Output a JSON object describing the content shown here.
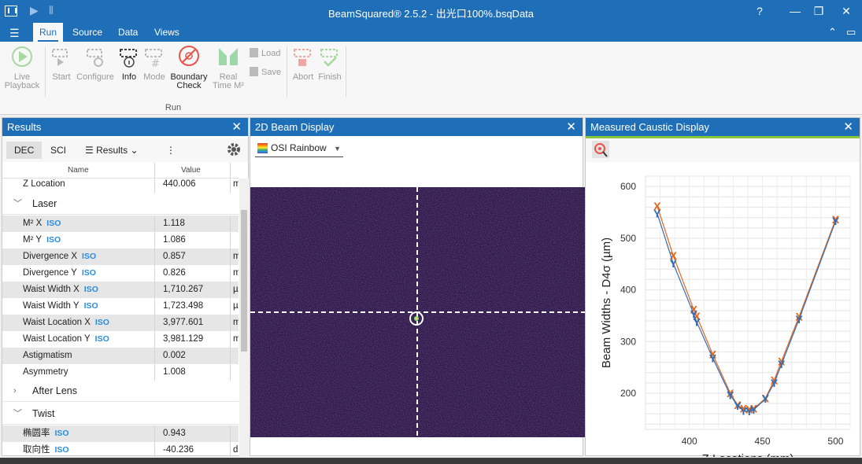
{
  "titlebar": {
    "title": "BeamSquared® 2.5.2 - 出光口100%.bsqData"
  },
  "menubar": {
    "tabs": [
      "Run",
      "Source",
      "Data",
      "Views"
    ]
  },
  "ribbon": {
    "live_playback": [
      "Live",
      "Playback"
    ],
    "start": "Start",
    "configure": "Configure",
    "info": "Info",
    "mode": "Mode",
    "boundary_check": [
      "Boundary",
      "Check"
    ],
    "real_time": [
      "Real",
      "Time M²"
    ],
    "load": "Load",
    "save": "Save",
    "abort": "Abort",
    "finish": "Finish",
    "group_label": "Run"
  },
  "results": {
    "title": "Results",
    "dec": "DEC",
    "sci": "SCI",
    "dropdown": "Results",
    "col_name": "Name",
    "col_value": "Value",
    "top_row": {
      "name": "Z Location",
      "value": "440.006",
      "unit": "m"
    },
    "group_laser": "Laser",
    "laser_rows": [
      {
        "name": "M² X",
        "iso": "ISO",
        "value": "1.118",
        "unit": ""
      },
      {
        "name": "M² Y",
        "iso": "ISO",
        "value": "1.086",
        "unit": ""
      },
      {
        "name": "Divergence X",
        "iso": "ISO",
        "value": "0.857",
        "unit": "m"
      },
      {
        "name": "Divergence Y",
        "iso": "ISO",
        "value": "0.826",
        "unit": "m"
      },
      {
        "name": "Waist Width X",
        "iso": "ISO",
        "value": "1,710.267",
        "unit": "µ"
      },
      {
        "name": "Waist Width Y",
        "iso": "ISO",
        "value": "1,723.498",
        "unit": "µ"
      },
      {
        "name": "Waist Location X",
        "iso": "ISO",
        "value": "3,977.601",
        "unit": "m"
      },
      {
        "name": "Waist Location Y",
        "iso": "ISO",
        "value": "3,981.129",
        "unit": "m"
      },
      {
        "name": "Astigmatism",
        "iso": "",
        "value": "0.002",
        "unit": ""
      },
      {
        "name": "Asymmetry",
        "iso": "",
        "value": "1.008",
        "unit": ""
      }
    ],
    "group_after_lens": "After Lens",
    "group_twist": "Twist",
    "twist_rows": [
      {
        "name": "椭圆率",
        "iso": "ISO",
        "value": "0.943",
        "unit": ""
      },
      {
        "name": "取向性",
        "iso": "ISO",
        "value": "-40.236",
        "unit": "d"
      }
    ]
  },
  "beam_display": {
    "title": "2D Beam Display",
    "colormap": "OSI Rainbow"
  },
  "caustic": {
    "title": "Measured Caustic Display"
  },
  "chart_data": {
    "type": "scatter",
    "xlabel": "Z Locations (mm)",
    "ylabel": "Beam Widths - D4σ (µm)",
    "xlim": [
      370,
      510
    ],
    "ylim": [
      130,
      620
    ],
    "x_ticks": [
      "400",
      "450",
      "500"
    ],
    "y_ticks": [
      "600",
      "500",
      "400",
      "300",
      "200"
    ],
    "grid": true,
    "legend": "none",
    "series": [
      {
        "marker": "X",
        "color": "#e8641a",
        "x": [
          378,
          389,
          403,
          405,
          416,
          428,
          433,
          437,
          441,
          444,
          452,
          458,
          463,
          475,
          500
        ],
        "y": [
          562,
          466,
          362,
          349,
          275,
          200,
          177,
          170,
          169,
          170,
          190,
          225,
          262,
          348,
          536
        ]
      },
      {
        "marker": "Y",
        "color": "#2f6db5",
        "x": [
          378,
          389,
          403,
          405,
          416,
          428,
          433,
          437,
          441,
          444,
          452,
          458,
          463,
          475,
          500
        ],
        "y": [
          548,
          451,
          353,
          338,
          268,
          196,
          176,
          166,
          165,
          168,
          189,
          220,
          256,
          343,
          533
        ]
      }
    ]
  }
}
